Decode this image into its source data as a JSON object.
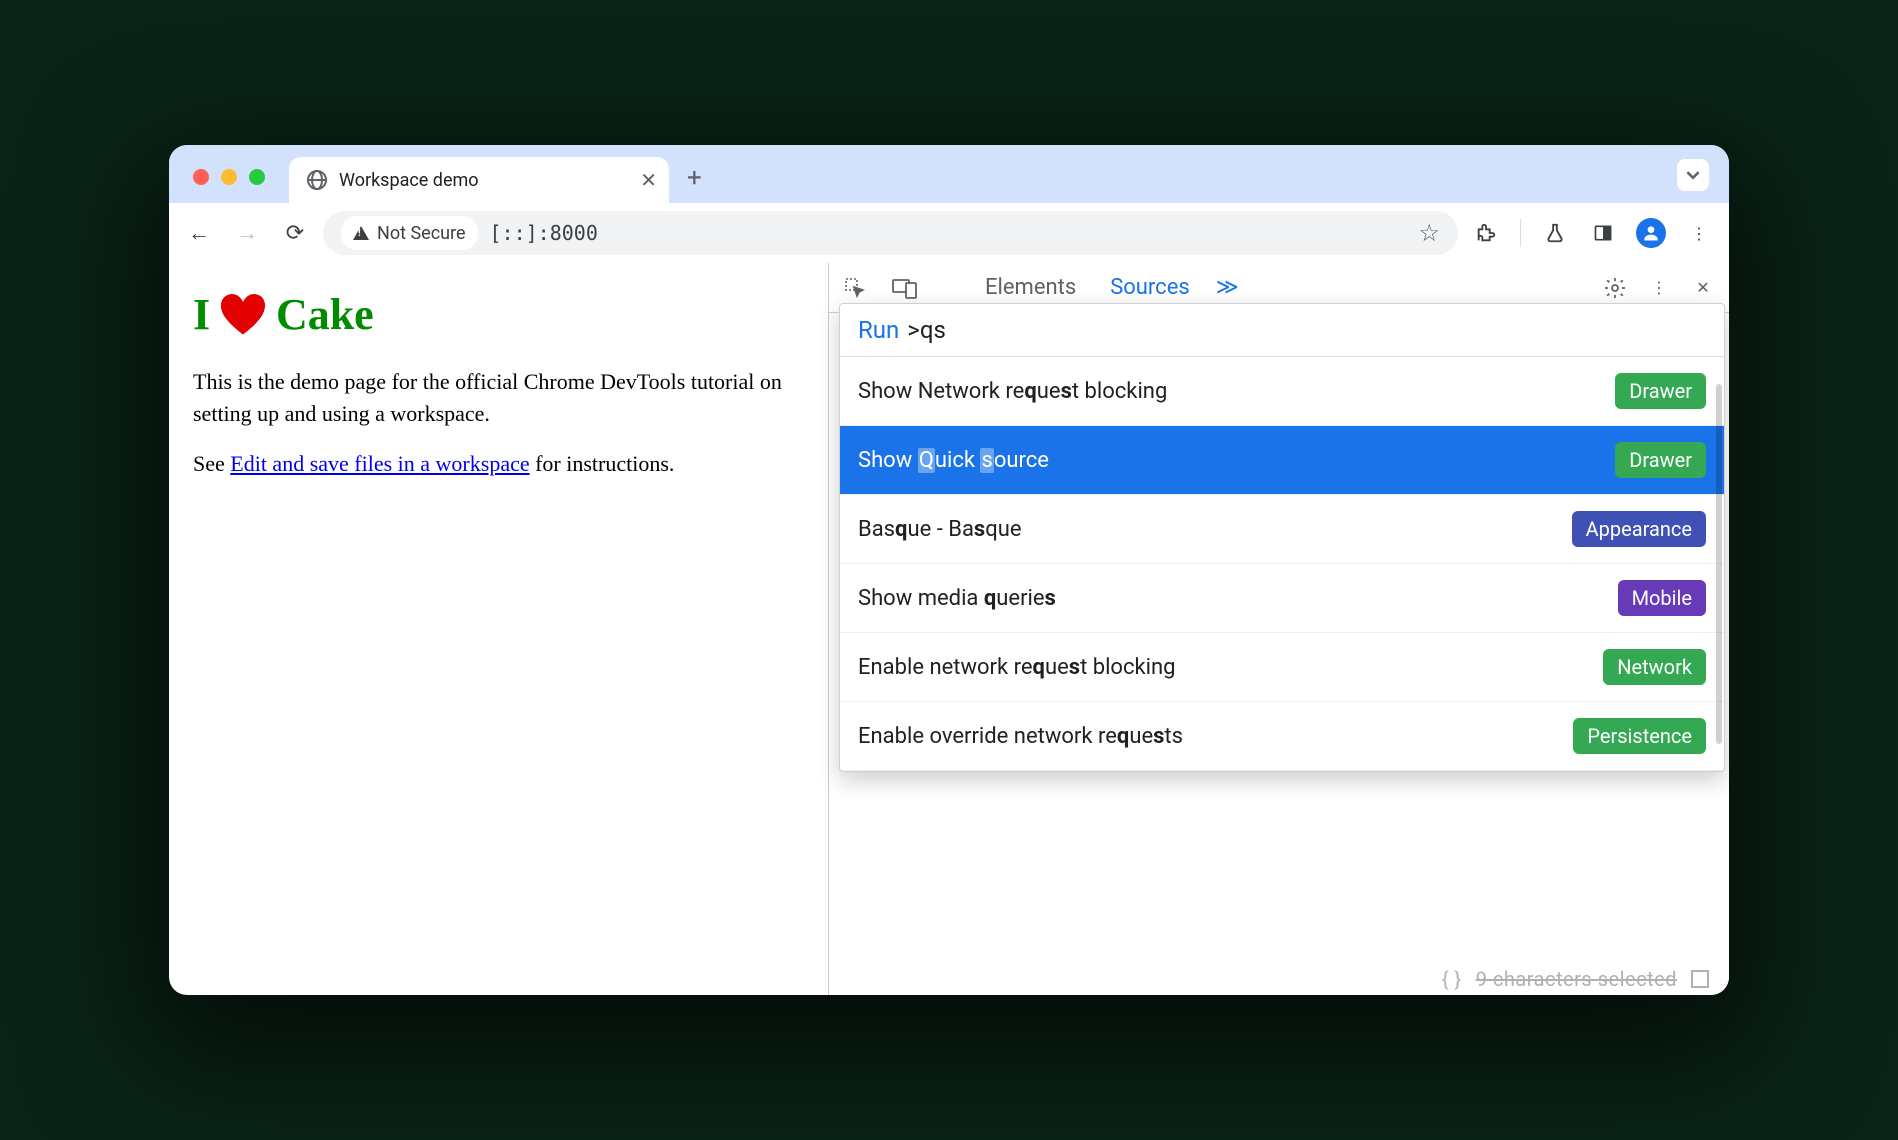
{
  "browser": {
    "tab_title": "Workspace demo",
    "not_secure": "Not Secure",
    "url": "[::]:8000"
  },
  "page": {
    "h1_pre": "I",
    "h1_post": "Cake",
    "p1": "This is the demo page for the official Chrome DevTools tutorial on setting up and using a workspace.",
    "p2_pre": "See ",
    "p2_link": "Edit and save files in a workspace",
    "p2_post": " for instructions."
  },
  "devtools": {
    "tabs": {
      "elements": "Elements",
      "sources": "Sources"
    },
    "cmd": {
      "run": "Run",
      "query": ">qs",
      "items": [
        {
          "label": "Show Network request blocking",
          "badge": "Drawer",
          "cls": "b-drawer"
        },
        {
          "label": "Show Quick source",
          "badge": "Drawer",
          "cls": "b-drawer",
          "selected": true
        },
        {
          "label": "Basque - Basque",
          "badge": "Appearance",
          "cls": "b-appearance"
        },
        {
          "label": "Show media queries",
          "badge": "Mobile",
          "cls": "b-mobile"
        },
        {
          "label": "Enable network request blocking",
          "badge": "Network",
          "cls": "b-network"
        },
        {
          "label": "Enable override network requests",
          "badge": "Persistence",
          "cls": "b-persist"
        }
      ]
    },
    "footer": "9 characters selected"
  }
}
